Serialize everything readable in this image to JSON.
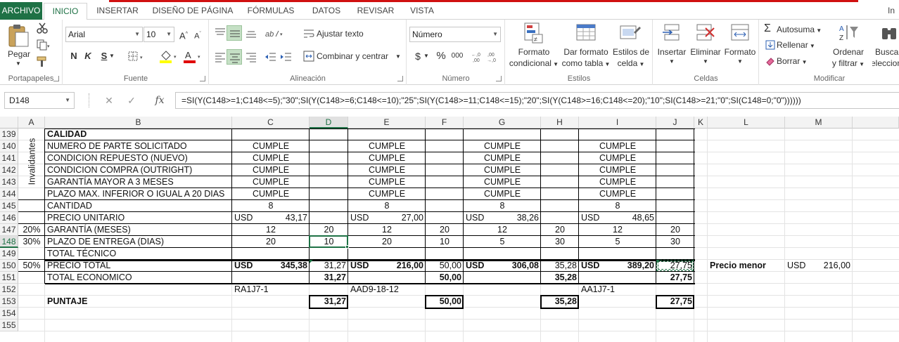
{
  "tabs": [
    "ARCHIVO",
    "INICIO",
    "INSERTAR",
    "DISEÑO DE PÁGINA",
    "FÓRMULAS",
    "DATOS",
    "REVISAR",
    "VISTA",
    "In"
  ],
  "ribbon": {
    "clipboard": {
      "label": "Portapapeles",
      "paste": "Pegar"
    },
    "font": {
      "label": "Fuente",
      "name": "Arial",
      "size": "10",
      "bold": "N",
      "italic": "K",
      "underline": "S"
    },
    "alignment": {
      "label": "Alineación",
      "wrap": "Ajustar texto",
      "merge": "Combinar y centrar"
    },
    "number": {
      "label": "Número",
      "format": "Número",
      "currency": "$",
      "percent": "%",
      "thousands": "000"
    },
    "styles": {
      "label": "Estilos",
      "cond1": "Formato",
      "cond2": "condicional",
      "table1": "Dar formato",
      "table2": "como tabla",
      "cell1": "Estilos de",
      "cell2": "celda"
    },
    "cells": {
      "label": "Celdas",
      "insert": "Insertar",
      "delete": "Eliminar",
      "format": "Formato"
    },
    "editing": {
      "label": "Modificar",
      "autosum": "Autosuma",
      "fill": "Rellenar",
      "clear": "Borrar",
      "sort1": "Ordenar",
      "sort2": "y filtrar",
      "find1": "Buscar",
      "find2": "seleccion"
    }
  },
  "formula_bar": {
    "name_box": "D148",
    "fx": "fx",
    "formula": "=SI(Y(C148>=1;C148<=5);\"30\";SI(Y(C148>=6;C148<=10);\"25\";SI(Y(C148>=11;C148<=15);\"20\";SI(Y(C148>=16;C148<=20);\"10\";SI(C148>=21;\"0\";SI(C148=0;\"0\"))))))"
  },
  "columns": [
    "A",
    "B",
    "C",
    "D",
    "E",
    "F",
    "G",
    "H",
    "I",
    "J",
    "K",
    "L",
    "M"
  ],
  "rows": [
    "139",
    "140",
    "141",
    "142",
    "143",
    "144",
    "145",
    "146",
    "147",
    "148",
    "149",
    "150",
    "151",
    "152",
    "153",
    "154",
    "155"
  ],
  "sheet": {
    "invalidantes": "Invalidantes",
    "b139": "CALIDAD",
    "b140": "NUMERO DE PARTE SOLICITADO",
    "b141": "CONDICION REPUESTO (NUEVO)",
    "b142": "CONDICION COMPRA (OUTRIGHT)",
    "b143": "GARANTÍA MAYOR A 3 MESES",
    "b144": "PLAZO MAX. INFERIOR O IGUAL A 20 DIAS",
    "b145": "CANTIDAD",
    "b146": "PRECIO UNITARIO",
    "b147": "GARANTÍA (MESES)",
    "b148": "PLAZO DE ENTREGA (DIAS)",
    "b149": "TOTAL TÉCNICO",
    "b150": "PRECIO TOTAL",
    "b151": "TOTAL ECONOMICO",
    "b153": "PUNTAJE",
    "a147": "20%",
    "a148": "30%",
    "a150": "50%",
    "cumple": "CUMPLE",
    "qty": "8",
    "usd": "USD",
    "c146": "43,17",
    "e146": "27,00",
    "g146": "38,26",
    "i146": "48,65",
    "c147": "12",
    "d147": "20",
    "e147": "12",
    "f147": "20",
    "g147": "12",
    "h147": "20",
    "i147": "12",
    "j147": "20",
    "c148": "20",
    "d148": "10",
    "e148": "20",
    "f148": "10",
    "g148": "5",
    "h148": "30",
    "i148": "5",
    "j148": "30",
    "c150": "345,38",
    "d150": "31,27",
    "e150": "216,00",
    "f150": "50,00",
    "g150": "306,08",
    "h150": "35,28",
    "i150": "389,20",
    "j150": "27,75",
    "d151": "31,27",
    "f151": "50,00",
    "h151": "35,28",
    "j151": "27,75",
    "c152": "RA1J7-1",
    "e152": "AAD9-18-12",
    "i152": "AA1J7-1",
    "d153": "31,27",
    "f153": "50,00",
    "h153": "35,28",
    "j153": "27,75",
    "l150": "Precio menor",
    "m150_usd": "USD",
    "m150": "216,00"
  }
}
